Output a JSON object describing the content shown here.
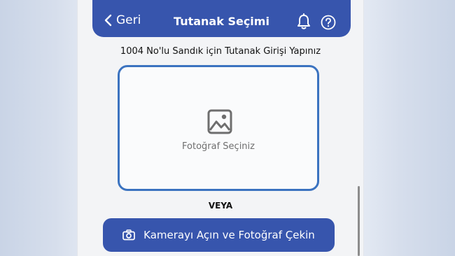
{
  "header": {
    "back_label": "Geri",
    "title": "Tutanak Seçimi",
    "icons": [
      "bell-icon",
      "help-icon",
      "chevron-left-icon"
    ]
  },
  "instruction": "1004 No'lu Sandık için Tutanak Girişi Yapınız",
  "photo_picker": {
    "label": "Fotoğraf Seçiniz",
    "icon": "image-icon"
  },
  "separator": "VEYA",
  "camera_button": {
    "label": "Kamerayı Açın ve Fotoğraf Çekin",
    "icon": "camera-icon"
  },
  "colors": {
    "primary": "#3755ad",
    "picker_border": "#3b73c0",
    "background": "#f3f4f6"
  }
}
